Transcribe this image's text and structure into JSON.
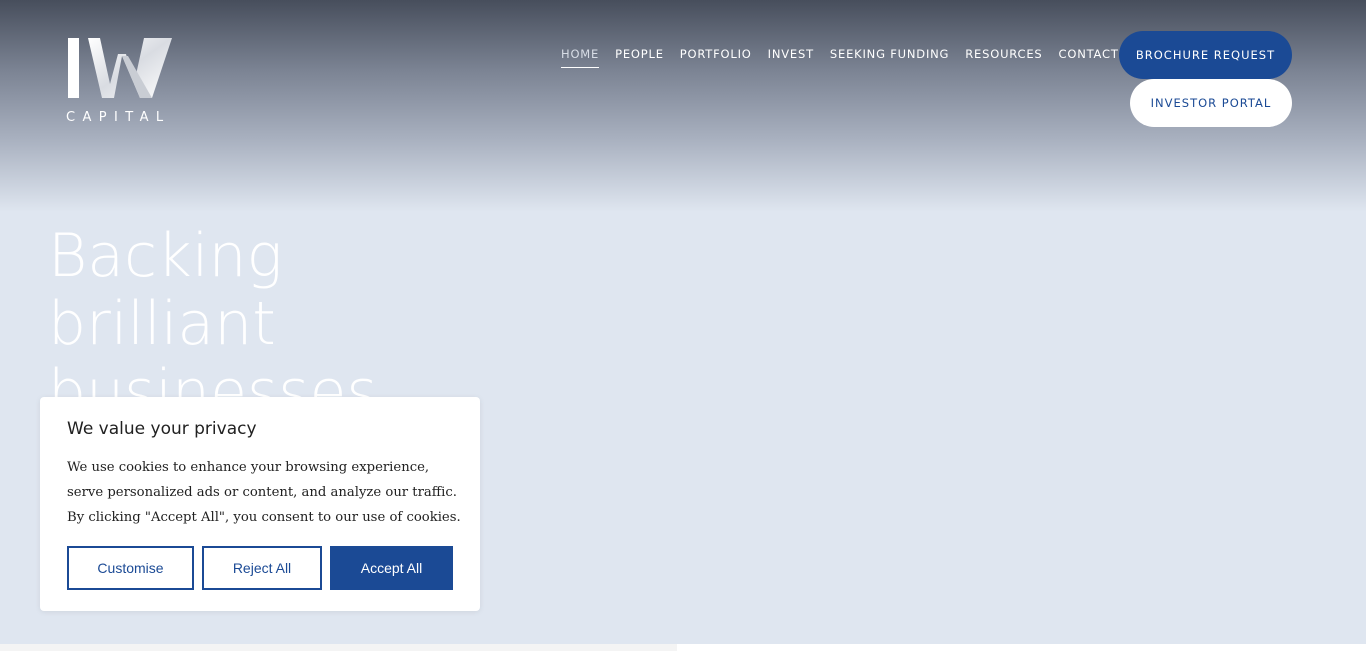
{
  "brand": {
    "logo_mark": "IW",
    "logo_subtext": "CAPITAL"
  },
  "nav": {
    "items": [
      {
        "label": "HOME",
        "active": true
      },
      {
        "label": "PEOPLE",
        "active": false
      },
      {
        "label": "PORTFOLIO",
        "active": false
      },
      {
        "label": "INVEST",
        "active": false
      },
      {
        "label": "SEEKING FUNDING",
        "active": false
      },
      {
        "label": "RESOURCES",
        "active": false
      },
      {
        "label": "CONTACT",
        "active": false
      }
    ],
    "brochure_label": "BROCHURE REQUEST",
    "portal_label": "INVESTOR PORTAL"
  },
  "hero": {
    "headline_lines": [
      "Backing",
      "brilliant",
      "businesses"
    ]
  },
  "cookie_banner": {
    "title": "We value your privacy",
    "text": "We use cookies to enhance your browsing experience, serve personalized ads or content, and analyze our traffic. By clicking \"Accept All\", you consent to our use of cookies.",
    "customise_label": "Customise",
    "reject_label": "Reject All",
    "accept_label": "Accept All"
  },
  "colors": {
    "brand_blue": "#1b4a95",
    "hero_bg": "#dfe6f0",
    "header_dark": "#474e5c"
  }
}
